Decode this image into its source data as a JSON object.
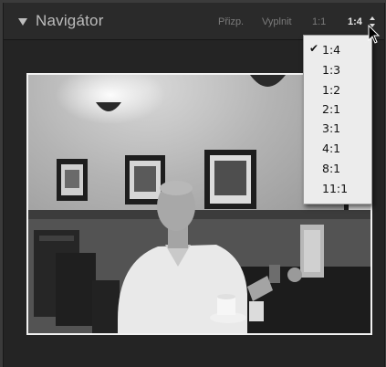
{
  "navigator": {
    "title": "Navigátor",
    "zoom_options": {
      "fit": "Přizp.",
      "fill": "Vyplnit",
      "one_to_one": "1:1",
      "current": "1:4"
    }
  },
  "zoom_menu": {
    "selected": "1:4",
    "items": [
      "1:4",
      "1:3",
      "1:2",
      "2:1",
      "3:1",
      "4:1",
      "8:1",
      "11:1"
    ]
  },
  "icons": {
    "collapse": "triangle-down-icon",
    "spinner": "up-down-arrows-icon",
    "checkmark": "checkmark-icon",
    "cursor": "mouse-pointer-icon"
  },
  "colors": {
    "panel_bg": "#242424",
    "header_text": "#bcbcbc",
    "menu_bg": "#ececec"
  }
}
